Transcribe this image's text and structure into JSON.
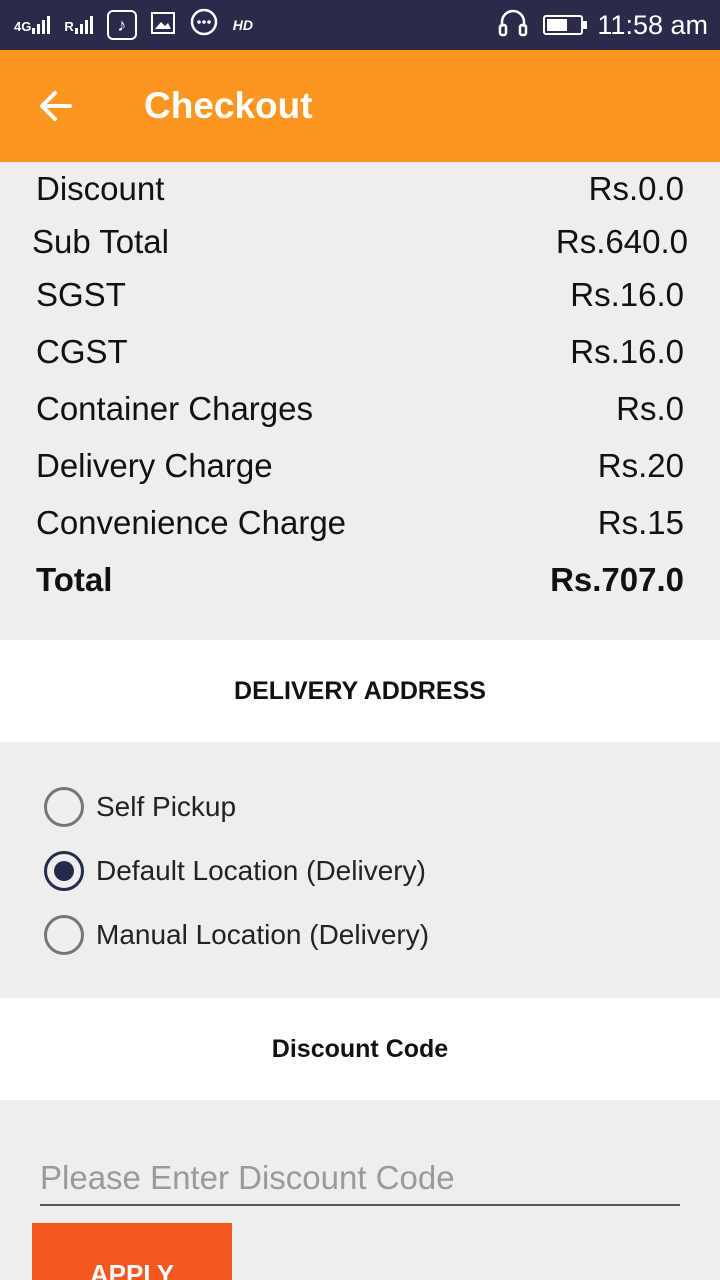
{
  "status_bar": {
    "network_1": "4G",
    "network_2": "R",
    "hd": "HD",
    "time": "11:58 am"
  },
  "app_bar": {
    "title": "Checkout",
    "accent": "#fd9620"
  },
  "summary": {
    "rows": [
      {
        "label": "Discount",
        "value": "Rs.0.0"
      },
      {
        "label": "Sub Total",
        "value": "Rs.640.0"
      },
      {
        "label": "SGST",
        "value": "Rs.16.0"
      },
      {
        "label": "CGST",
        "value": "Rs.16.0"
      },
      {
        "label": "Container Charges",
        "value": "Rs.0"
      },
      {
        "label": "Delivery Charge",
        "value": "Rs.20"
      },
      {
        "label": "Convenience Charge",
        "value": "Rs.15"
      }
    ],
    "total": {
      "label": "Total",
      "value": "Rs.707.0"
    }
  },
  "delivery": {
    "heading": "DELIVERY ADDRESS",
    "options": [
      {
        "label": "Self Pickup",
        "selected": false
      },
      {
        "label": "Default Location (Delivery)",
        "selected": true
      },
      {
        "label": "Manual Location (Delivery)",
        "selected": false
      }
    ]
  },
  "discount": {
    "heading": "Discount Code",
    "placeholder": "Please Enter Discount Code",
    "value": "",
    "apply_label": "APPLY",
    "apply_color": "#f4581f"
  }
}
